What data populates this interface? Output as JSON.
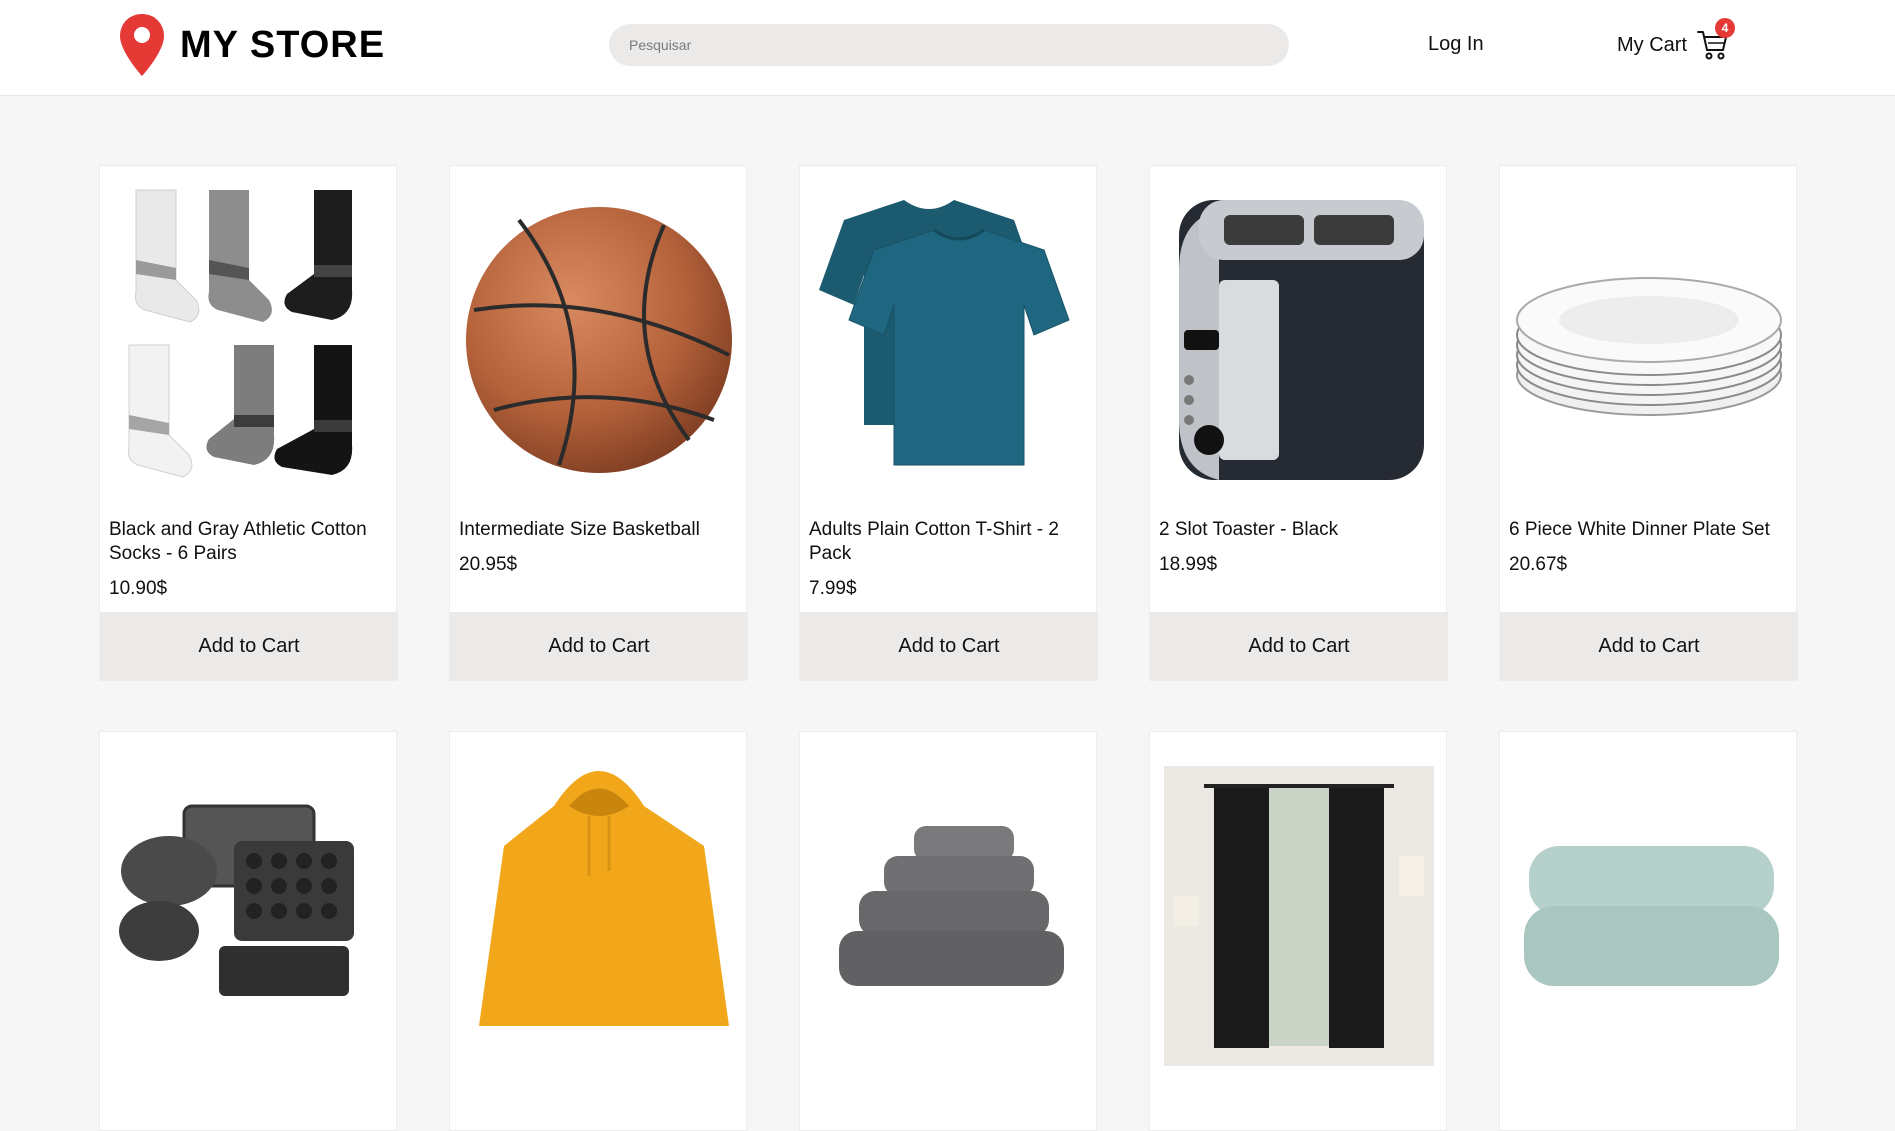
{
  "header": {
    "logo_text": "MY STORE",
    "search_placeholder": "Pesquisar",
    "login_label": "Log In",
    "cart_label": "My Cart",
    "cart_count": "4"
  },
  "products": [
    {
      "name": "Black and Gray Athletic Cotton Socks - 6 Pairs",
      "price": "10.90$",
      "button": "Add to Cart",
      "image": "socks"
    },
    {
      "name": "Intermediate Size Basketball",
      "price": "20.95$",
      "button": "Add to Cart",
      "image": "basketball"
    },
    {
      "name": "Adults Plain Cotton T-Shirt - 2 Pack",
      "price": "7.99$",
      "button": "Add to Cart",
      "image": "tshirt"
    },
    {
      "name": "2 Slot Toaster - Black",
      "price": "18.99$",
      "button": "Add to Cart",
      "image": "toaster"
    },
    {
      "name": "6 Piece White Dinner Plate Set",
      "price": "20.67$",
      "button": "Add to Cart",
      "image": "plates"
    },
    {
      "image": "bakeware"
    },
    {
      "image": "hoodie"
    },
    {
      "image": "towels"
    },
    {
      "image": "curtains"
    },
    {
      "image": "blanket"
    }
  ],
  "colors": {
    "accent": "#e53935",
    "button_bg": "#ece9e9",
    "page_bg": "#f6f6f6"
  }
}
